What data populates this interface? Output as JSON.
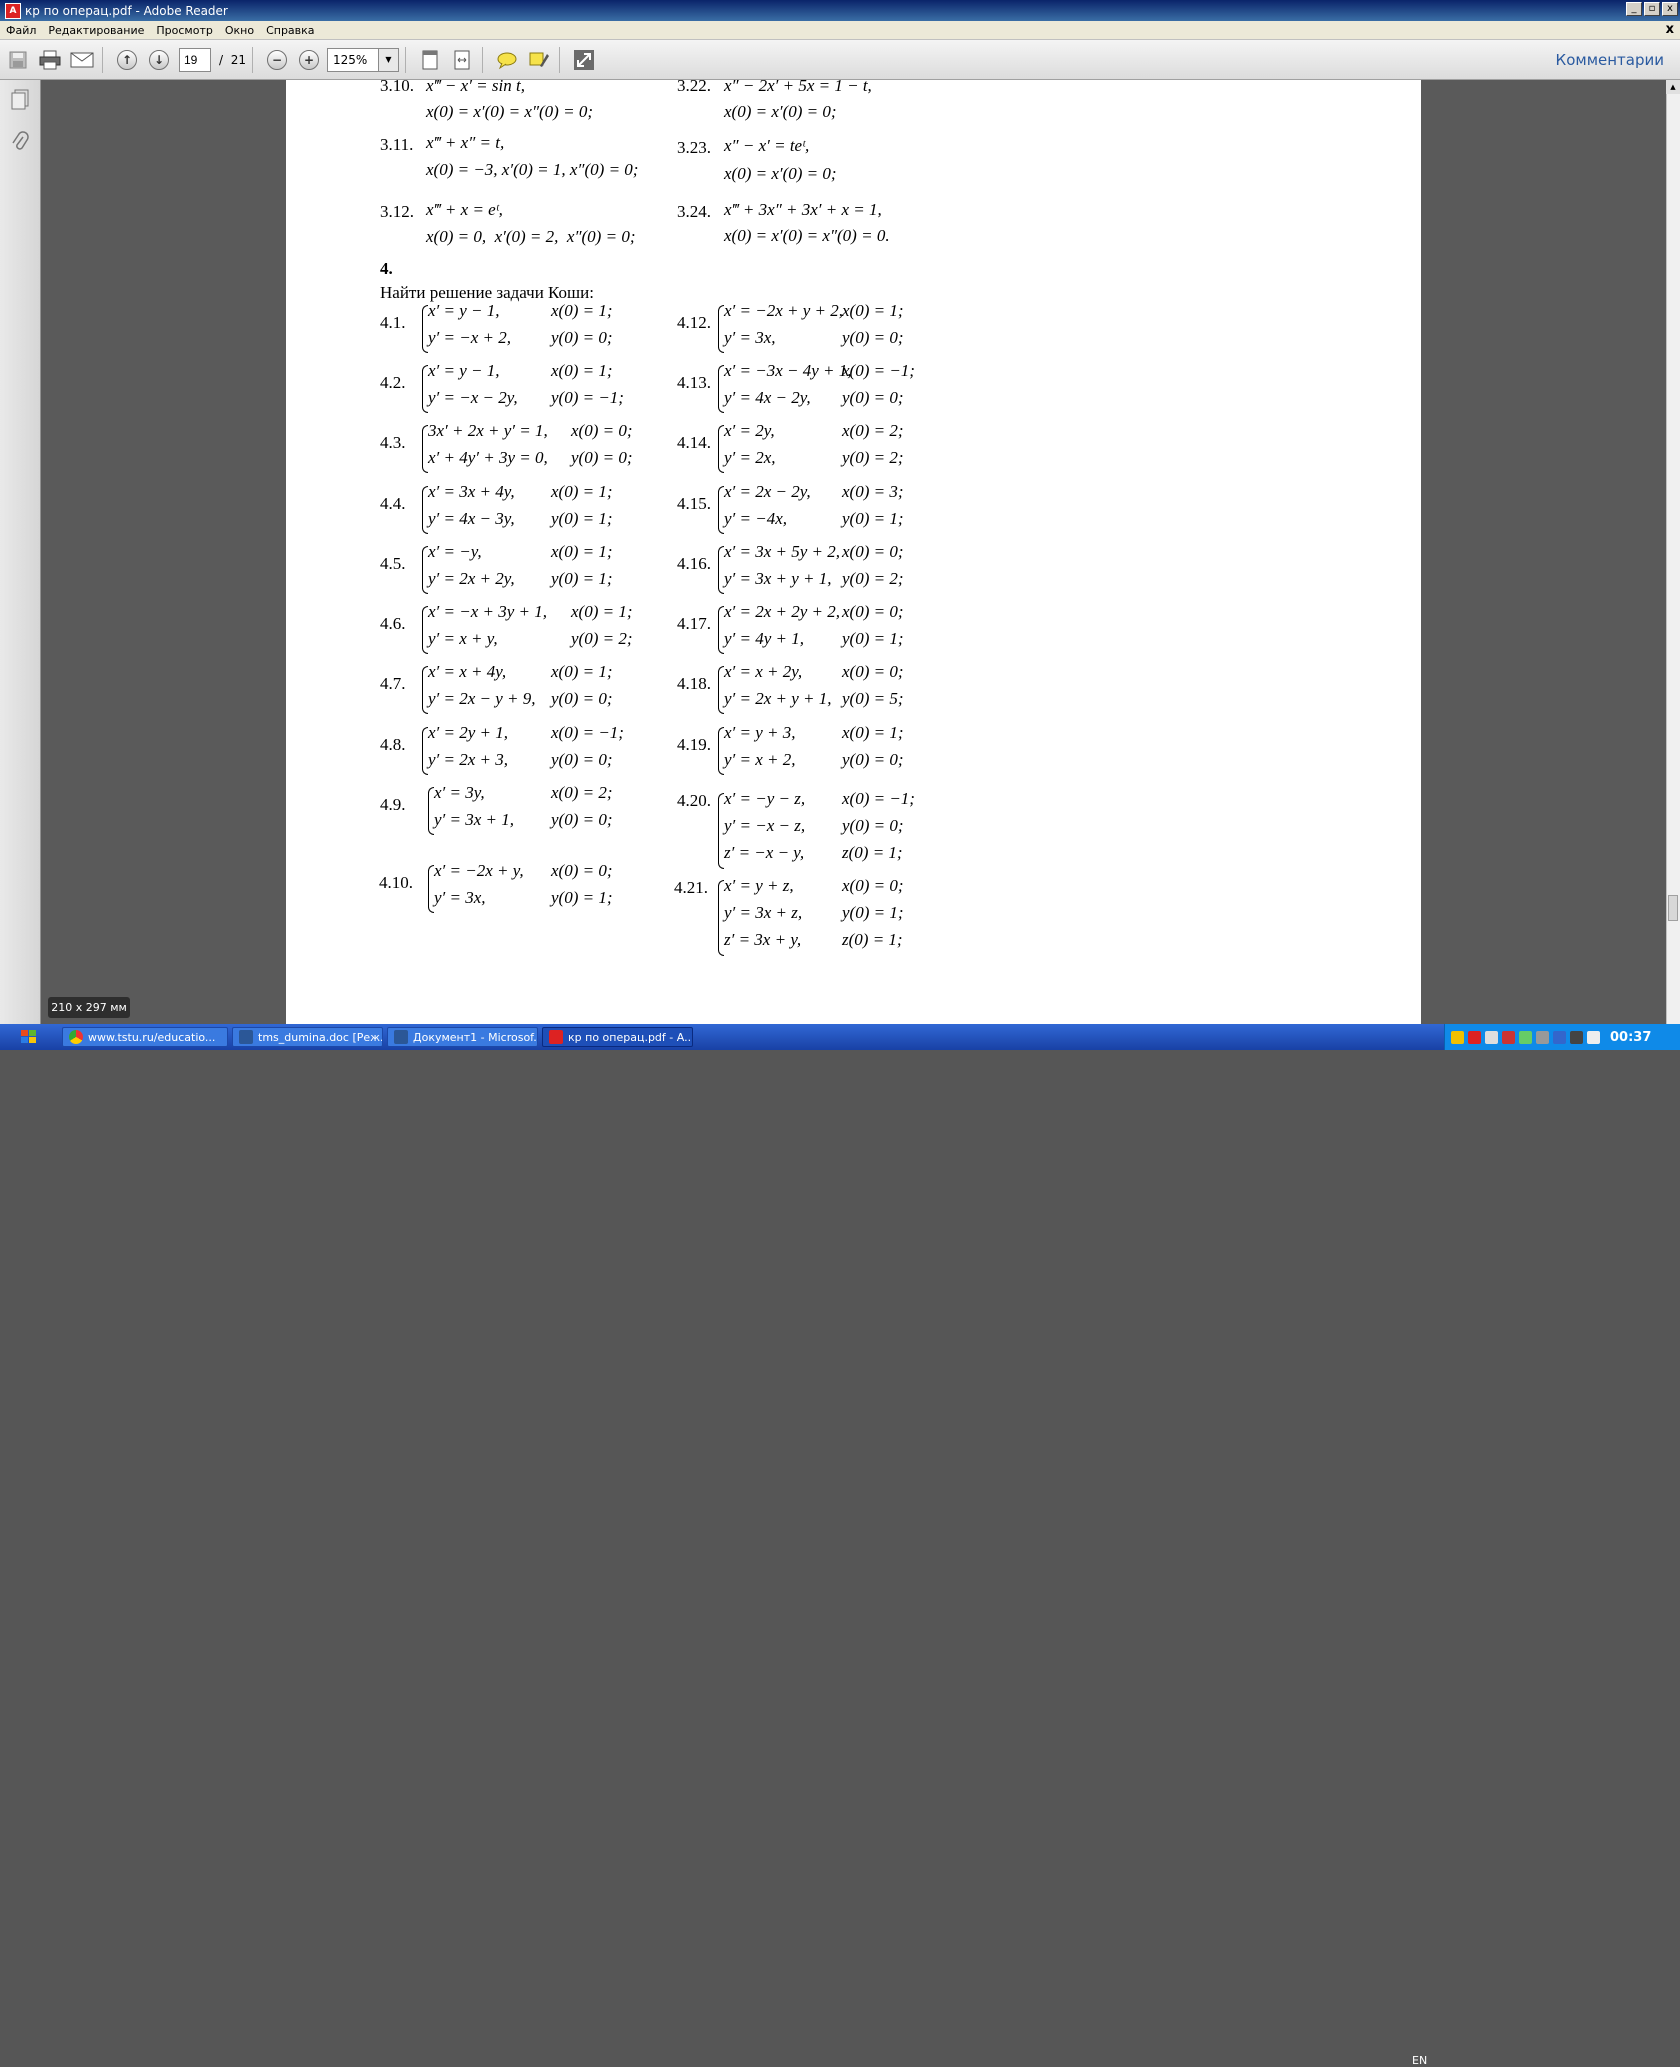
{
  "window": {
    "title": "кр по операц.pdf - Adobe Reader",
    "buttons": [
      "_",
      "▫",
      "x"
    ]
  },
  "menu": {
    "items": [
      "Файл",
      "Редактирование",
      "Просмотр",
      "Окно",
      "Справка"
    ],
    "close": "x"
  },
  "toolbar": {
    "page_current": "19",
    "page_separator": "/",
    "page_total": "21",
    "zoom": "125%",
    "comments_label": "Комментарии"
  },
  "status": {
    "page_size": "210 x 297 мм"
  },
  "document": {
    "section3": [
      {
        "num": "3.10.",
        "eq": "x‴ − x′ = sin t,",
        "init": "x(0) = x′(0) = x″(0) = 0;"
      },
      {
        "num": "3.22.",
        "eq": "x″ − 2x′ + 5x = 1 − t,",
        "init": "x(0) = x′(0) = 0;"
      },
      {
        "num": "3.11.",
        "eq": "x‴ + x″ = t,",
        "init": "x(0) = −3, x′(0) = 1, x″(0) = 0;"
      },
      {
        "num": "3.23.",
        "eq": "x″ − x′ = teᵗ,",
        "init": "x(0) = x′(0) = 0;"
      },
      {
        "num": "3.12.",
        "eq": "x‴ + x = eᵗ,",
        "init": "x(0) = 0,  x′(0) = 2,  x″(0) = 0;"
      },
      {
        "num": "3.24.",
        "eq": "x‴ + 3x″ + 3x′ + x = 1,",
        "init": "x(0) = x′(0) = x″(0) = 0."
      }
    ],
    "section4_heading": "4.",
    "section4_title": "Найти решение задачи Коши:",
    "left_problems": [
      {
        "num": "4.1.",
        "l1": "x′ = y − 1,",
        "c1": "x(0) = 1;",
        "l2": "y′ = −x + 2,",
        "c2": "y(0) = 0;"
      },
      {
        "num": "4.2.",
        "l1": "x′ = y − 1,",
        "c1": "x(0) = 1;",
        "l2": "y′ = −x − 2y,",
        "c2": "y(0) = −1;"
      },
      {
        "num": "4.3.",
        "l1": "3x′ + 2x + y′ = 1,",
        "c1": "x(0) = 0;",
        "l2": "x′ + 4y′ + 3y = 0,",
        "c2": "y(0) = 0;"
      },
      {
        "num": "4.4.",
        "l1": "x′ = 3x + 4y,",
        "c1": "x(0) = 1;",
        "l2": "y′ = 4x − 3y,",
        "c2": "y(0) = 1;"
      },
      {
        "num": "4.5.",
        "l1": "x′ = −y,",
        "c1": "x(0) = 1;",
        "l2": "y′ = 2x + 2y,",
        "c2": "y(0) = 1;"
      },
      {
        "num": "4.6.",
        "l1": "x′ = −x + 3y + 1,",
        "c1": "x(0) = 1;",
        "l2": "y′ = x + y,",
        "c2": "y(0) = 2;"
      },
      {
        "num": "4.7.",
        "l1": "x′ = x + 4y,",
        "c1": "x(0) = 1;",
        "l2": "y′ = 2x − y + 9,",
        "c2": "y(0) = 0;"
      },
      {
        "num": "4.8.",
        "l1": "x′ = 2y + 1,",
        "c1": "x(0) = −1;",
        "l2": "y′ = 2x + 3,",
        "c2": "y(0) = 0;"
      },
      {
        "num": "4.9.",
        "l1": "x′ = 3y,",
        "c1": "x(0) = 2;",
        "l2": "y′ = 3x + 1,",
        "c2": "y(0) = 0;"
      },
      {
        "num": "4.10.",
        "l1": "x′ = −2x + y,",
        "c1": "x(0) = 0;",
        "l2": "y′ = 3x,",
        "c2": "y(0) = 1;"
      }
    ],
    "right_problems": [
      {
        "num": "4.12.",
        "l1": "x′ = −2x + y + 2,",
        "c1": "x(0) = 1;",
        "l2": "y′ = 3x,",
        "c2": "y(0) = 0;"
      },
      {
        "num": "4.13.",
        "l1": "x′ = −3x − 4y + 1,",
        "c1": "x(0) = −1;",
        "l2": "y′ = 4x − 2y,",
        "c2": "y(0) = 0;"
      },
      {
        "num": "4.14.",
        "l1": "x′ = 2y,",
        "c1": "x(0) = 2;",
        "l2": "y′ = 2x,",
        "c2": "y(0) = 2;"
      },
      {
        "num": "4.15.",
        "l1": "x′ = 2x − 2y,",
        "c1": "x(0) = 3;",
        "l2": "y′ = −4x,",
        "c2": "y(0) = 1;"
      },
      {
        "num": "4.16.",
        "l1": "x′ = 3x + 5y + 2,",
        "c1": "x(0) = 0;",
        "l2": "y′ = 3x + y + 1,",
        "c2": "y(0) = 2;"
      },
      {
        "num": "4.17.",
        "l1": "x′ = 2x + 2y + 2,",
        "c1": "x(0) = 0;",
        "l2": "y′ = 4y + 1,",
        "c2": "y(0) = 1;"
      },
      {
        "num": "4.18.",
        "l1": "x′ = x + 2y,",
        "c1": "x(0) = 0;",
        "l2": "y′ = 2x + y + 1,",
        "c2": "y(0) = 5;"
      },
      {
        "num": "4.19.",
        "l1": "x′ = y + 3,",
        "c1": "x(0) = 1;",
        "l2": "y′ = x + 2,",
        "c2": "y(0) = 0;"
      }
    ],
    "p420": {
      "num": "4.20.",
      "l1": "x′ = −y − z,",
      "c1": "x(0) = −1;",
      "l2": "y′ = −x − z,",
      "c2": "y(0) = 0;",
      "l3": "z′ = −x − y,",
      "c3": "z(0) = 1;"
    },
    "p421": {
      "num": "4.21.",
      "l1": "x′ = y + z,",
      "c1": "x(0) = 0;",
      "l2": "y′ = 3x + z,",
      "c2": "y(0) = 1;",
      "l3": "z′ = 3x + y,",
      "c3": "z(0) = 1;"
    }
  },
  "taskbar": {
    "tasks": [
      "www.tstu.ru/educatio...",
      "tms_dumina.doc [Реж...",
      "Документ1 - Microsof...",
      "кр по операц.pdf - A..."
    ],
    "lang": "EN",
    "clock": "00:37"
  },
  "colors": {
    "title_bar": "#0a246a",
    "taskbar": "#245edb",
    "doc_bg": "#5a5a5a",
    "link": "#2a5aa0"
  }
}
